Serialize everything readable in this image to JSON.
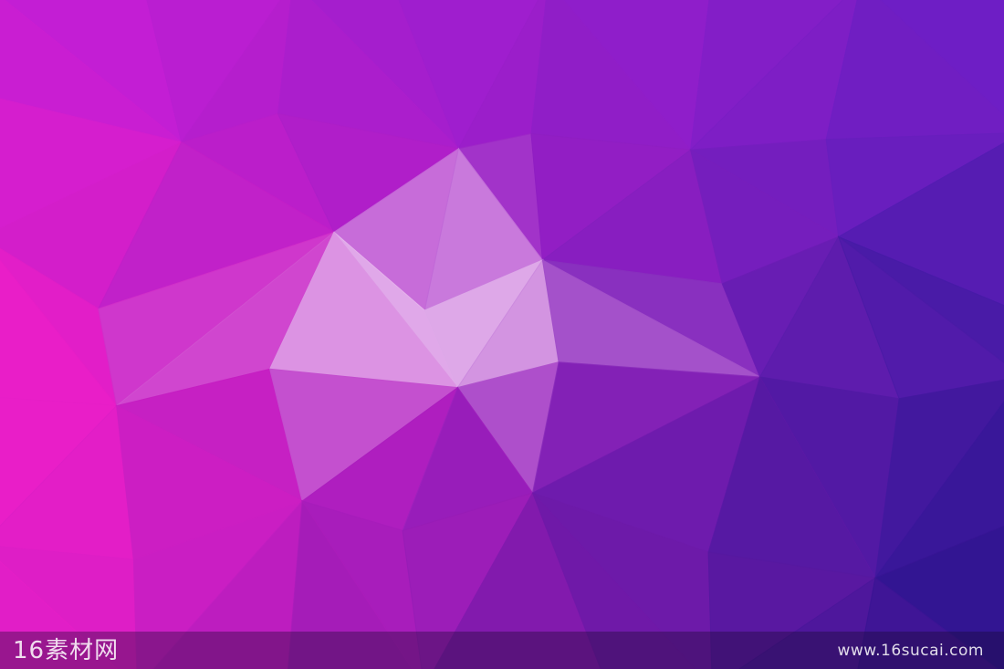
{
  "watermark": {
    "logo_text": "16素材网",
    "site_url": "www.16sucai.com"
  },
  "palette": {
    "magenta": "#e81ed0",
    "violet": "#a020e8",
    "indigo": "#4a1fa8",
    "deep_blue": "#2a1680",
    "highlight": "#f5e6ff"
  }
}
